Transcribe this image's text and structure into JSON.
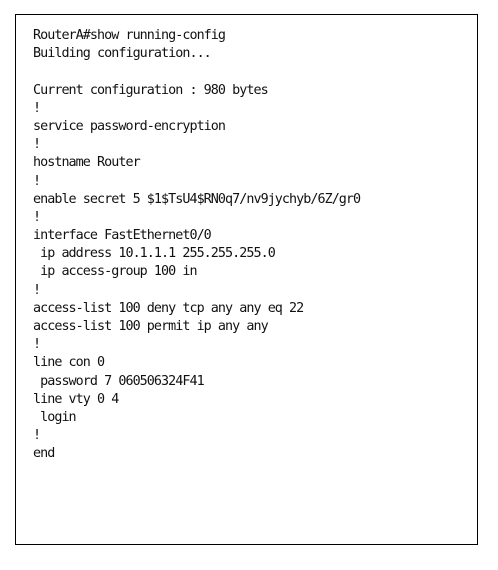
{
  "terminal": {
    "lines": [
      "RouterA#show running-config",
      "Building configuration...",
      "",
      "Current configuration : 980 bytes",
      "!",
      "service password-encryption",
      "!",
      "hostname Router",
      "!",
      "enable secret 5 $1$TsU4$RN0q7/nv9jychyb/6Z/gr0",
      "!",
      "interface FastEthernet0/0",
      " ip address 10.1.1.1 255.255.255.0",
      " ip access-group 100 in",
      "!",
      "access-list 100 deny tcp any any eq 22",
      "access-list 100 permit ip any any",
      "!",
      "line con 0",
      " password 7 060506324F41",
      "line vty 0 4",
      " login",
      "!",
      "end"
    ]
  }
}
